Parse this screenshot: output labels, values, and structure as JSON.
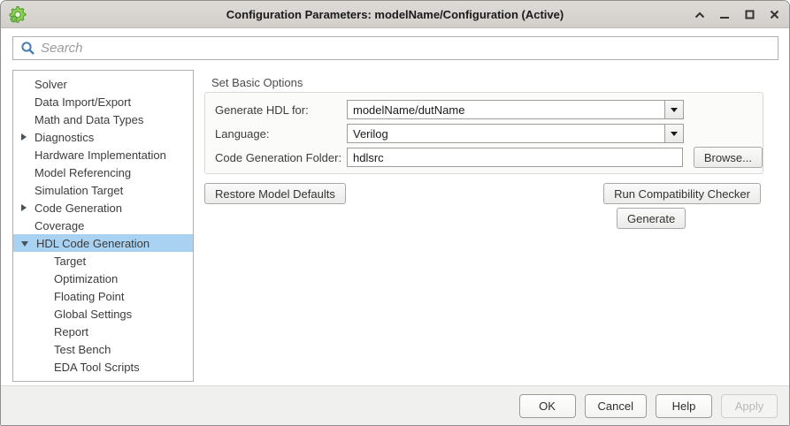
{
  "window": {
    "title": "Configuration Parameters: modelName/Configuration (Active)"
  },
  "search": {
    "placeholder": "Search",
    "value": ""
  },
  "sidebar": {
    "items": [
      {
        "label": "Solver",
        "level": 0,
        "arrow": "none",
        "selected": false
      },
      {
        "label": "Data Import/Export",
        "level": 0,
        "arrow": "none",
        "selected": false
      },
      {
        "label": "Math and Data Types",
        "level": 0,
        "arrow": "none",
        "selected": false
      },
      {
        "label": "Diagnostics",
        "level": 0,
        "arrow": "collapsed",
        "selected": false
      },
      {
        "label": "Hardware Implementation",
        "level": 0,
        "arrow": "none",
        "selected": false
      },
      {
        "label": "Model Referencing",
        "level": 0,
        "arrow": "none",
        "selected": false
      },
      {
        "label": "Simulation Target",
        "level": 0,
        "arrow": "none",
        "selected": false
      },
      {
        "label": "Code Generation",
        "level": 0,
        "arrow": "collapsed",
        "selected": false
      },
      {
        "label": "Coverage",
        "level": 0,
        "arrow": "none",
        "selected": false
      },
      {
        "label": "HDL Code Generation",
        "level": 0,
        "arrow": "expanded",
        "selected": true
      },
      {
        "label": "Target",
        "level": 1,
        "arrow": "none",
        "selected": false
      },
      {
        "label": "Optimization",
        "level": 1,
        "arrow": "none",
        "selected": false
      },
      {
        "label": "Floating Point",
        "level": 1,
        "arrow": "none",
        "selected": false
      },
      {
        "label": "Global Settings",
        "level": 1,
        "arrow": "none",
        "selected": false
      },
      {
        "label": "Report",
        "level": 1,
        "arrow": "none",
        "selected": false
      },
      {
        "label": "Test Bench",
        "level": 1,
        "arrow": "none",
        "selected": false
      },
      {
        "label": "EDA Tool Scripts",
        "level": 1,
        "arrow": "none",
        "selected": false
      }
    ]
  },
  "main": {
    "heading": "Set Basic Options",
    "fields": [
      {
        "label": "Generate HDL for:",
        "value": "modelName/dutName",
        "type": "combo"
      },
      {
        "label": "Language:",
        "value": "Verilog",
        "type": "combo"
      },
      {
        "label": "Code Generation Folder:",
        "value": "hdlsrc",
        "type": "text",
        "button": "Browse..."
      }
    ],
    "buttons": {
      "restore_defaults": "Restore Model Defaults",
      "run_compatibility": "Run Compatibility Checker",
      "generate": "Generate"
    }
  },
  "footer": {
    "ok": "OK",
    "cancel": "Cancel",
    "help": "Help",
    "apply": "Apply",
    "apply_enabled": false
  },
  "colors": {
    "selection_blue": "#a9d2f2",
    "titlebar_gray": "#d7d3d0",
    "logo_green": "#76c043",
    "search_icon_blue": "#4a7db1"
  }
}
